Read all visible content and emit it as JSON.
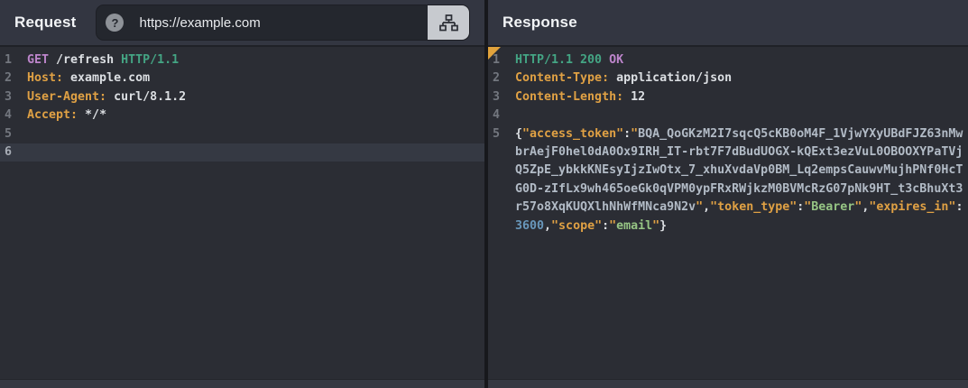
{
  "request": {
    "title": "Request",
    "url_bar": {
      "help_glyph": "?",
      "help_icon_name": "question-mark-icon",
      "url": "https://example.com",
      "connect_icon_name": "sitemap-icon"
    },
    "editor": {
      "lines": [
        {
          "num": "1",
          "tokens": [
            {
              "t": "GET",
              "c": "purple"
            },
            {
              "t": " /refresh ",
              "c": "white"
            },
            {
              "t": "HTTP/1.1",
              "c": "green"
            }
          ]
        },
        {
          "num": "2",
          "tokens": [
            {
              "t": "Host:",
              "c": "orange"
            },
            {
              "t": " example.com",
              "c": "white"
            }
          ]
        },
        {
          "num": "3",
          "tokens": [
            {
              "t": "User-Agent:",
              "c": "orange"
            },
            {
              "t": " curl/8.1.2",
              "c": "white"
            }
          ]
        },
        {
          "num": "4",
          "tokens": [
            {
              "t": "Accept:",
              "c": "orange"
            },
            {
              "t": " */*",
              "c": "white"
            }
          ]
        },
        {
          "num": "5",
          "tokens": []
        },
        {
          "num": "6",
          "tokens": [],
          "active": true
        }
      ]
    }
  },
  "response": {
    "title": "Response",
    "corner_marker": "modified-indicator",
    "editor": {
      "lines": [
        {
          "num": "1",
          "tokens": [
            {
              "t": "HTTP/1.1 200",
              "c": "green"
            },
            {
              "t": " ",
              "c": "white"
            },
            {
              "t": "OK",
              "c": "purple"
            }
          ]
        },
        {
          "num": "2",
          "tokens": [
            {
              "t": "Content-Type:",
              "c": "orange"
            },
            {
              "t": " application/json",
              "c": "white"
            }
          ]
        },
        {
          "num": "3",
          "tokens": [
            {
              "t": "Content-Length:",
              "c": "orange"
            },
            {
              "t": " 12",
              "c": "white"
            }
          ]
        },
        {
          "num": "4",
          "tokens": []
        },
        {
          "num": "5",
          "tokens": [
            {
              "t": "{",
              "c": "white"
            },
            {
              "t": "\"access_token\"",
              "c": "orange"
            },
            {
              "t": ":",
              "c": "white"
            },
            {
              "t": "\"",
              "c": "orange"
            },
            {
              "t": "BQA_QoGKzM2I7sqcQ5cKB0oM4F_1VjwYXyUBdFJZ63nMwbrAejF0hel0dA0Ox9IRH_IT-rbt7F7dBudUOGX-kQExt3ezVuL0OBOOXYPaTVjQ5ZpE_ybkkKNEsyIjzIwOtx_7_xhuXvdaVp0BM_Lq2empsCauwvMujhPNf0HcTG0D-zIfLx9wh465oeGk0qVPM0ypFRxRWjkzM0BVMcRzG07pNk9HT_t3cBhuXt3r57o8XqKUQXlhNhWfMNca9N2v",
              "c": "gray"
            },
            {
              "t": "\"",
              "c": "orange"
            },
            {
              "t": ",",
              "c": "white"
            },
            {
              "t": "\"token_type\"",
              "c": "orange"
            },
            {
              "t": ":",
              "c": "white"
            },
            {
              "t": "\"",
              "c": "orange"
            },
            {
              "t": "Bearer",
              "c": "green2"
            },
            {
              "t": "\"",
              "c": "orange"
            },
            {
              "t": ",",
              "c": "white"
            },
            {
              "t": "\"expires_in\"",
              "c": "orange"
            },
            {
              "t": ":",
              "c": "white"
            },
            {
              "t": "3600",
              "c": "blue"
            },
            {
              "t": ",",
              "c": "white"
            },
            {
              "t": "\"scope\"",
              "c": "orange"
            },
            {
              "t": ":",
              "c": "white"
            },
            {
              "t": "\"",
              "c": "orange"
            },
            {
              "t": "email",
              "c": "green2"
            },
            {
              "t": "\"",
              "c": "orange"
            },
            {
              "t": "}",
              "c": "white"
            }
          ]
        }
      ]
    }
  },
  "colors": {
    "header_bg": "#333641",
    "editor_bg": "#2B2D34",
    "active_line_bg": "#353943",
    "key_orange": "#E0A144",
    "method_purple": "#BD85CB",
    "protocol_green": "#44A584",
    "string_value_green": "#96C584",
    "number_blue": "#6897BB",
    "token_value_gray": "#B2BBC6",
    "corner_marker_orange": "#E2A33C",
    "connect_button_bg": "#C7CACF"
  }
}
